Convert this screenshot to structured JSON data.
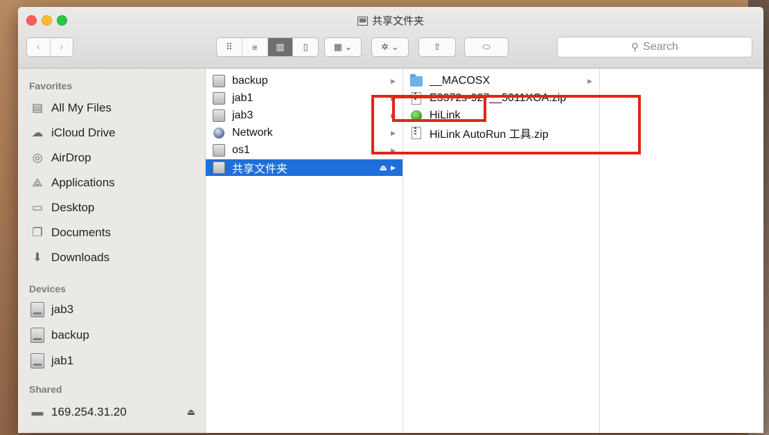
{
  "window": {
    "title": "共享文件夹"
  },
  "toolbar": {
    "search_label": "Search",
    "view_modes": [
      "icon",
      "list",
      "column",
      "cover-flow"
    ]
  },
  "sidebar": {
    "favorites_header": "Favorites",
    "favorites": [
      {
        "label": "All My Files",
        "icon": "all-files-icon"
      },
      {
        "label": "iCloud Drive",
        "icon": "cloud-icon"
      },
      {
        "label": "AirDrop",
        "icon": "airdrop-icon"
      },
      {
        "label": "Applications",
        "icon": "applications-icon"
      },
      {
        "label": "Desktop",
        "icon": "desktop-icon"
      },
      {
        "label": "Documents",
        "icon": "documents-icon"
      },
      {
        "label": "Downloads",
        "icon": "downloads-icon"
      }
    ],
    "devices_header": "Devices",
    "devices": [
      {
        "label": "jab3"
      },
      {
        "label": "backup"
      },
      {
        "label": "jab1"
      }
    ],
    "shared_header": "Shared",
    "shared": [
      {
        "label": "169.254.31.20"
      }
    ]
  },
  "column1": {
    "items": [
      {
        "label": "backup",
        "icon": "drive-icon",
        "has_children": true
      },
      {
        "label": "jab1",
        "icon": "drive-icon",
        "has_children": true
      },
      {
        "label": "jab3",
        "icon": "drive-icon",
        "has_children": true
      },
      {
        "label": "Network",
        "icon": "network-icon",
        "has_children": true
      },
      {
        "label": "os1",
        "icon": "drive-icon",
        "has_children": true
      },
      {
        "label": "共享文件夹",
        "icon": "shared-folder-icon",
        "has_children": true,
        "selected": true
      }
    ]
  },
  "column2": {
    "items": [
      {
        "label": "__MACOSX",
        "icon": "folder-icon",
        "has_children": true
      },
      {
        "label": "E3372s-927__5011XOA.zip",
        "icon": "zip-icon"
      },
      {
        "label": "HiLink",
        "icon": "app-icon"
      },
      {
        "label": "HiLink AutoRun 工具.zip",
        "icon": "zip-icon"
      }
    ]
  },
  "colors": {
    "selection": "#1e6fd9",
    "highlight_box": "#e2231a"
  }
}
